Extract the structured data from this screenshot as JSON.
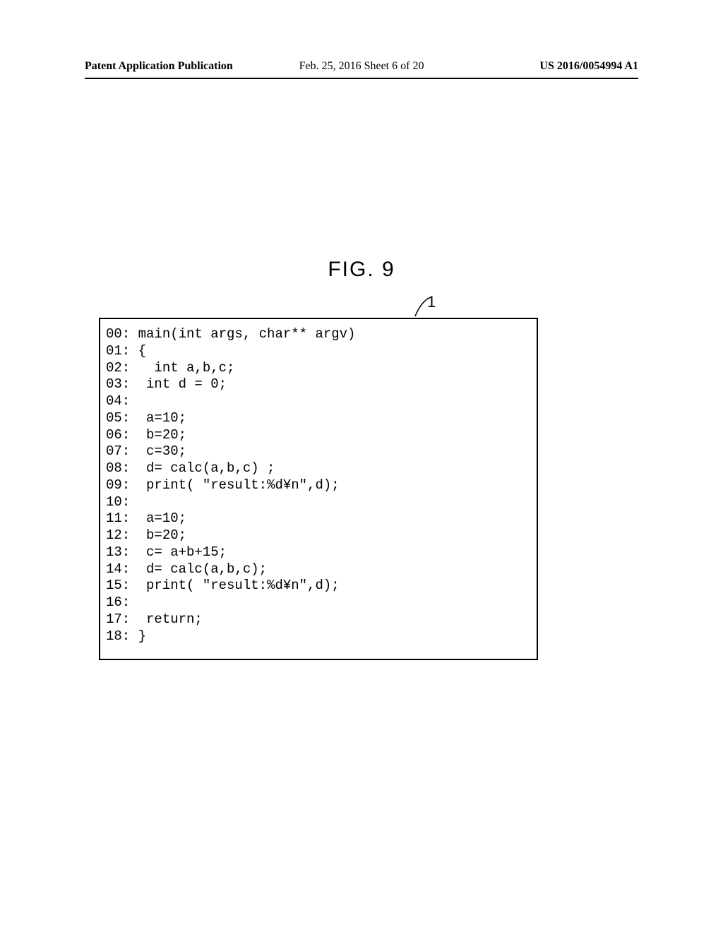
{
  "header": {
    "left": "Patent Application Publication",
    "center": "Feb. 25, 2016  Sheet 6 of 20",
    "right": "US 2016/0054994 A1"
  },
  "figure": {
    "label": "FIG. 9",
    "callout": "1"
  },
  "code": {
    "lines": [
      "00: main(int args, char** argv)",
      "01: {",
      "02:   int a,b,c;",
      "03:  int d = 0;",
      "04:",
      "05:  a=10;",
      "06:  b=20;",
      "07:  c=30;",
      "08:  d= calc(a,b,c) ;",
      "09:  print( \"result:%d¥n\",d);",
      "10:",
      "11:  a=10;",
      "12:  b=20;",
      "13:  c= a+b+15;",
      "14:  d= calc(a,b,c);",
      "15:  print( \"result:%d¥n\",d);",
      "16:",
      "17:  return;",
      "18: }"
    ]
  }
}
